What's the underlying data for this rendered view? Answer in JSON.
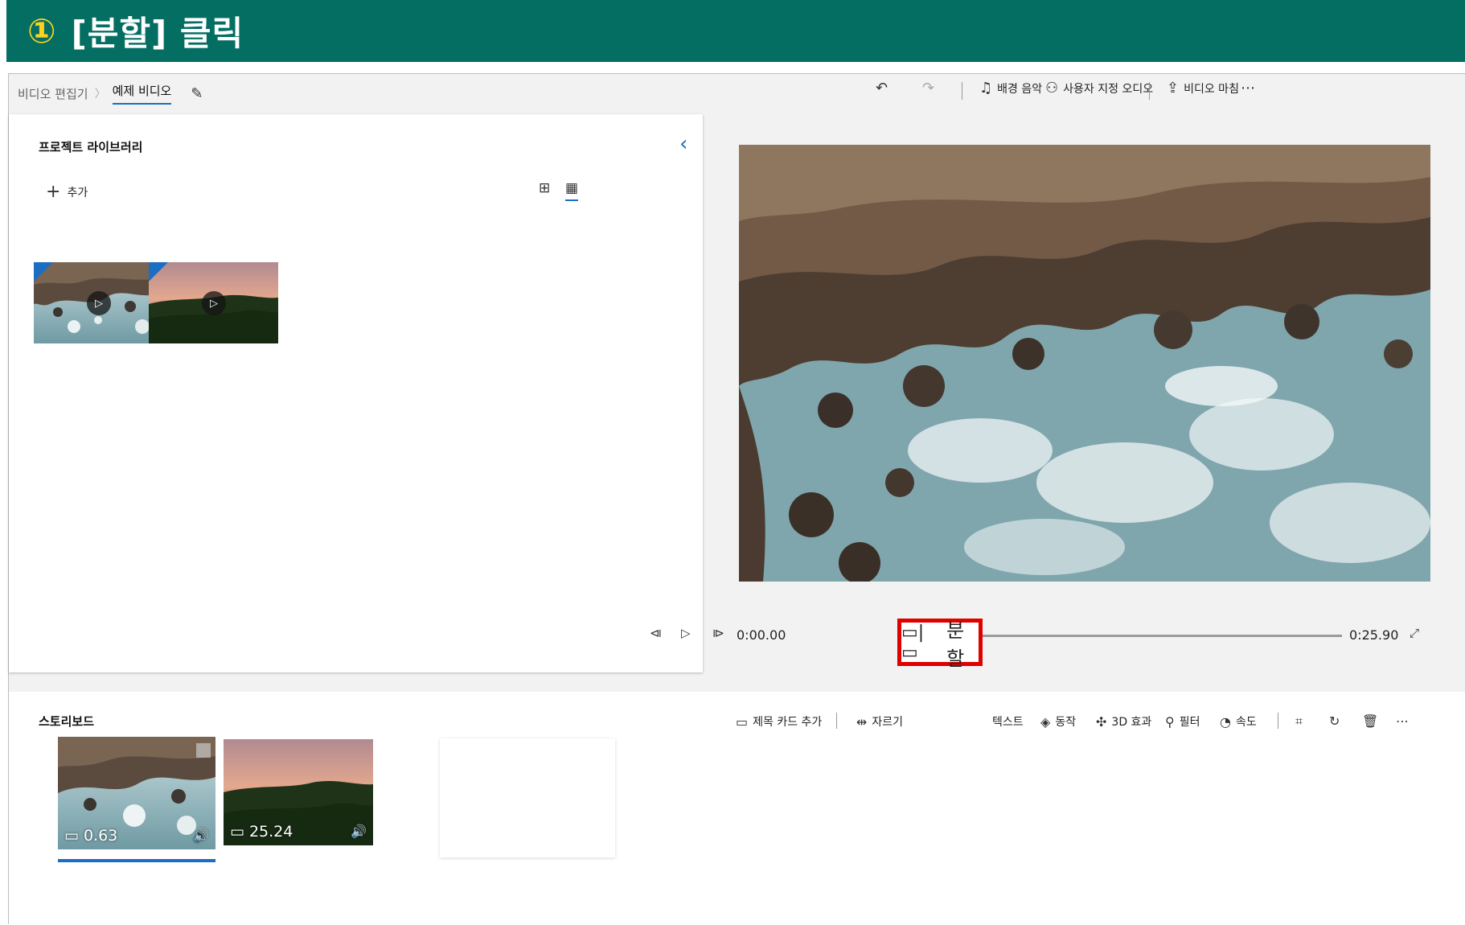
{
  "banner": {
    "step": "①",
    "text": "[분할] 클릭"
  },
  "breadcrumb": {
    "parent": "비디오 편집기",
    "separator": "〉",
    "current": "예제 비디오"
  },
  "toolbar": {
    "bg_music": "배경 음악",
    "custom_audio": "사용자 지정 오디오",
    "finish_video": "비디오 마침",
    "more": "⋯"
  },
  "library": {
    "title": "프로젝트 라이브러리",
    "add_label": "추가"
  },
  "player": {
    "current_time": "0:00.00",
    "total_time": "0:25.90",
    "progress": 0
  },
  "storyboard": {
    "title": "스토리보드",
    "title_card": "제목 카드 추가",
    "trim": "자르기",
    "split": "분할",
    "text": "텍스트",
    "motion": "동작",
    "effects_3d": "3D 효과",
    "filters": "필터",
    "speed": "속도",
    "more": "⋯",
    "clips": [
      {
        "duration": "0.63"
      },
      {
        "duration": "25.24"
      }
    ]
  },
  "colors": {
    "banner": "#046e62",
    "accent": "#1b6ec2",
    "highlight": "#e00000",
    "step": "#ffd21f"
  }
}
